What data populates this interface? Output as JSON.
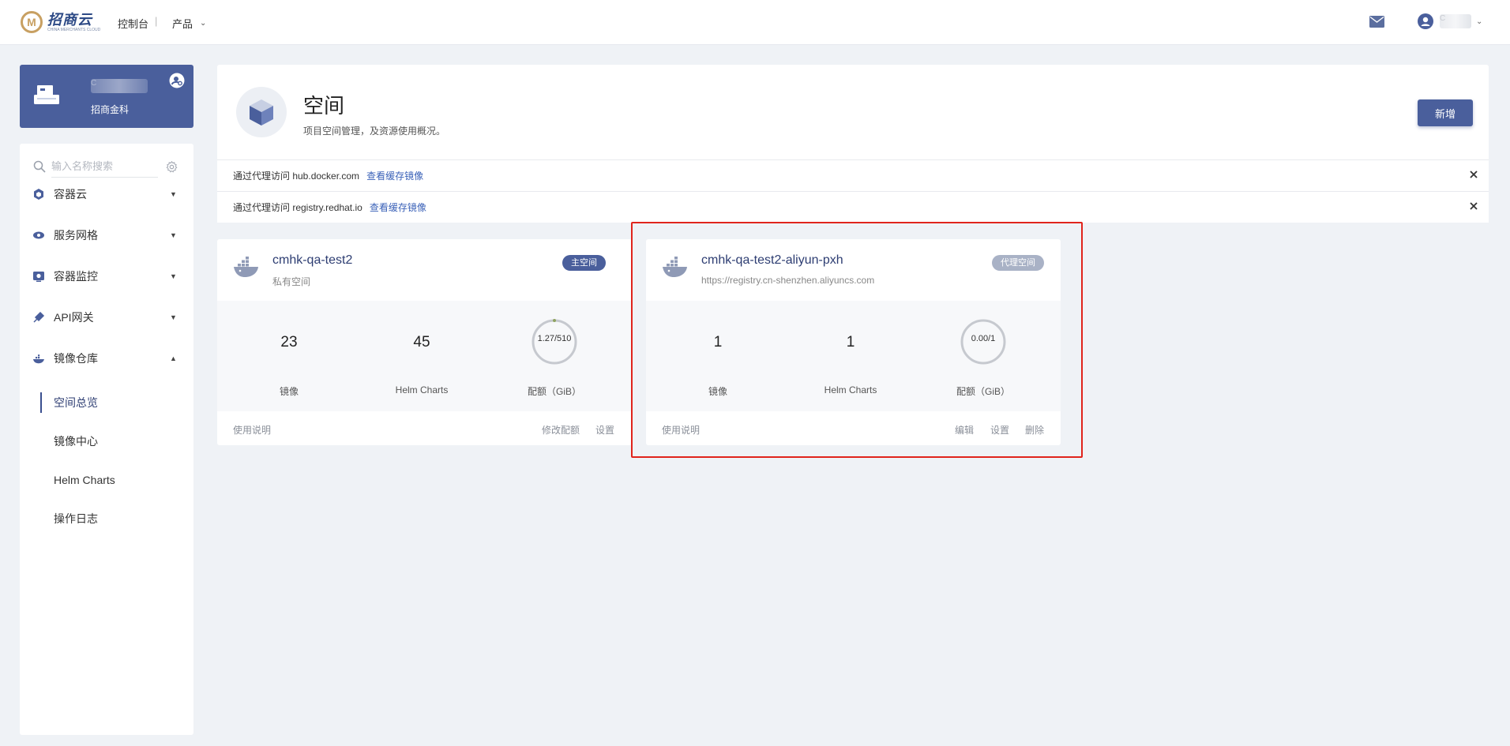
{
  "header": {
    "logo_mark": "M",
    "logo_cn": "招商云",
    "logo_en": "CHINA MERCHANTS CLOUD",
    "nav_console": "控制台",
    "nav_separator": "|",
    "nav_product": "产品",
    "user_name_blurred": "C"
  },
  "org": {
    "name_blurred": "C",
    "subtitle": "招商金科"
  },
  "sidebar": {
    "search_placeholder": "输入名称搜索",
    "menu": [
      {
        "label": "容器云",
        "icon": "container-cloud-icon",
        "expanded": false
      },
      {
        "label": "服务网格",
        "icon": "service-mesh-icon",
        "expanded": false
      },
      {
        "label": "容器监控",
        "icon": "container-monitor-icon",
        "expanded": false
      },
      {
        "label": "API网关",
        "icon": "api-gateway-icon",
        "expanded": false
      },
      {
        "label": "镜像仓库",
        "icon": "image-registry-icon",
        "expanded": true
      }
    ],
    "submenu": [
      {
        "label": "空间总览",
        "active": true
      },
      {
        "label": "镜像中心",
        "active": false
      },
      {
        "label": "Helm Charts",
        "active": false
      },
      {
        "label": "操作日志",
        "active": false
      }
    ]
  },
  "main": {
    "title": "空间",
    "description": "项目空间管理，及资源使用概况。",
    "new_button": "新增",
    "notices": [
      {
        "text": "通过代理访问 hub.docker.com",
        "link": "查看缓存镜像"
      },
      {
        "text": "通过代理访问 registry.redhat.io",
        "link": "查看缓存镜像"
      }
    ],
    "cards": [
      {
        "title": "cmhk-qa-test2",
        "subtitle": "私有空间",
        "badge": "主空间",
        "badge_color": "#4a5f9c",
        "images": "23",
        "images_label": "镜像",
        "charts": "45",
        "charts_label": "Helm Charts",
        "quota": "1.27/510",
        "quota_label": "配额（GiB）",
        "quota_used_fraction": 0.0025,
        "footer_left": "使用说明",
        "footer_actions": [
          "修改配额",
          "设置"
        ]
      },
      {
        "title": "cmhk-qa-test2-aliyun-pxh",
        "subtitle": "https://registry.cn-shenzhen.aliyuncs.com",
        "badge": "代理空间",
        "badge_color": "#a9b2c6",
        "images": "1",
        "images_label": "镜像",
        "charts": "1",
        "charts_label": "Helm Charts",
        "quota": "0.00/1",
        "quota_label": "配额（GiB）",
        "quota_used_fraction": 0,
        "footer_left": "使用说明",
        "footer_actions": [
          "编辑",
          "设置",
          "删除"
        ]
      }
    ]
  },
  "colors": {
    "primary": "#4a5f9c",
    "highlight_border": "#e0241c",
    "link": "#3b62b8"
  }
}
